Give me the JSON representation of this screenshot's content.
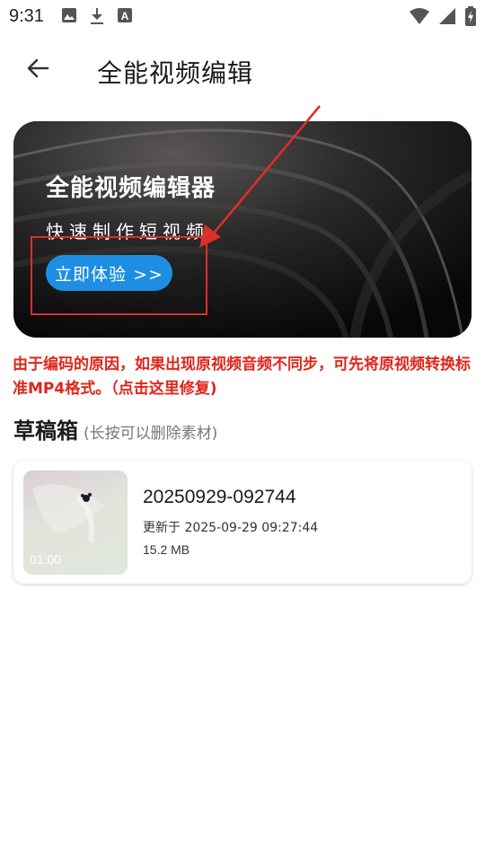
{
  "status_bar": {
    "time": "9:31",
    "left_icons": [
      "image-icon",
      "download-icon",
      "font-icon"
    ],
    "right_icons": [
      "wifi-icon",
      "signal-icon",
      "battery-icon"
    ]
  },
  "app_bar": {
    "title": "全能视频编辑",
    "back_icon": "arrow-left-icon"
  },
  "banner": {
    "title": "全能视频编辑器",
    "subtitle": "快速制作短视频",
    "button_label": "立即体验 >>",
    "button_color": "#1e8ee3"
  },
  "notice": {
    "text": "由于编码的原因，如果出现原视频音频不同步，可先将原视频转换标准MP4格式。（点击这里修复)",
    "color": "#e0251b"
  },
  "drafts": {
    "title": "草稿箱",
    "hint": "(长按可以删除素材)",
    "items": [
      {
        "name": "20250929-092744",
        "updated": "更新于 2025-09-29 09:27:44",
        "size": "15.2 MB",
        "duration": "01:00"
      }
    ]
  }
}
